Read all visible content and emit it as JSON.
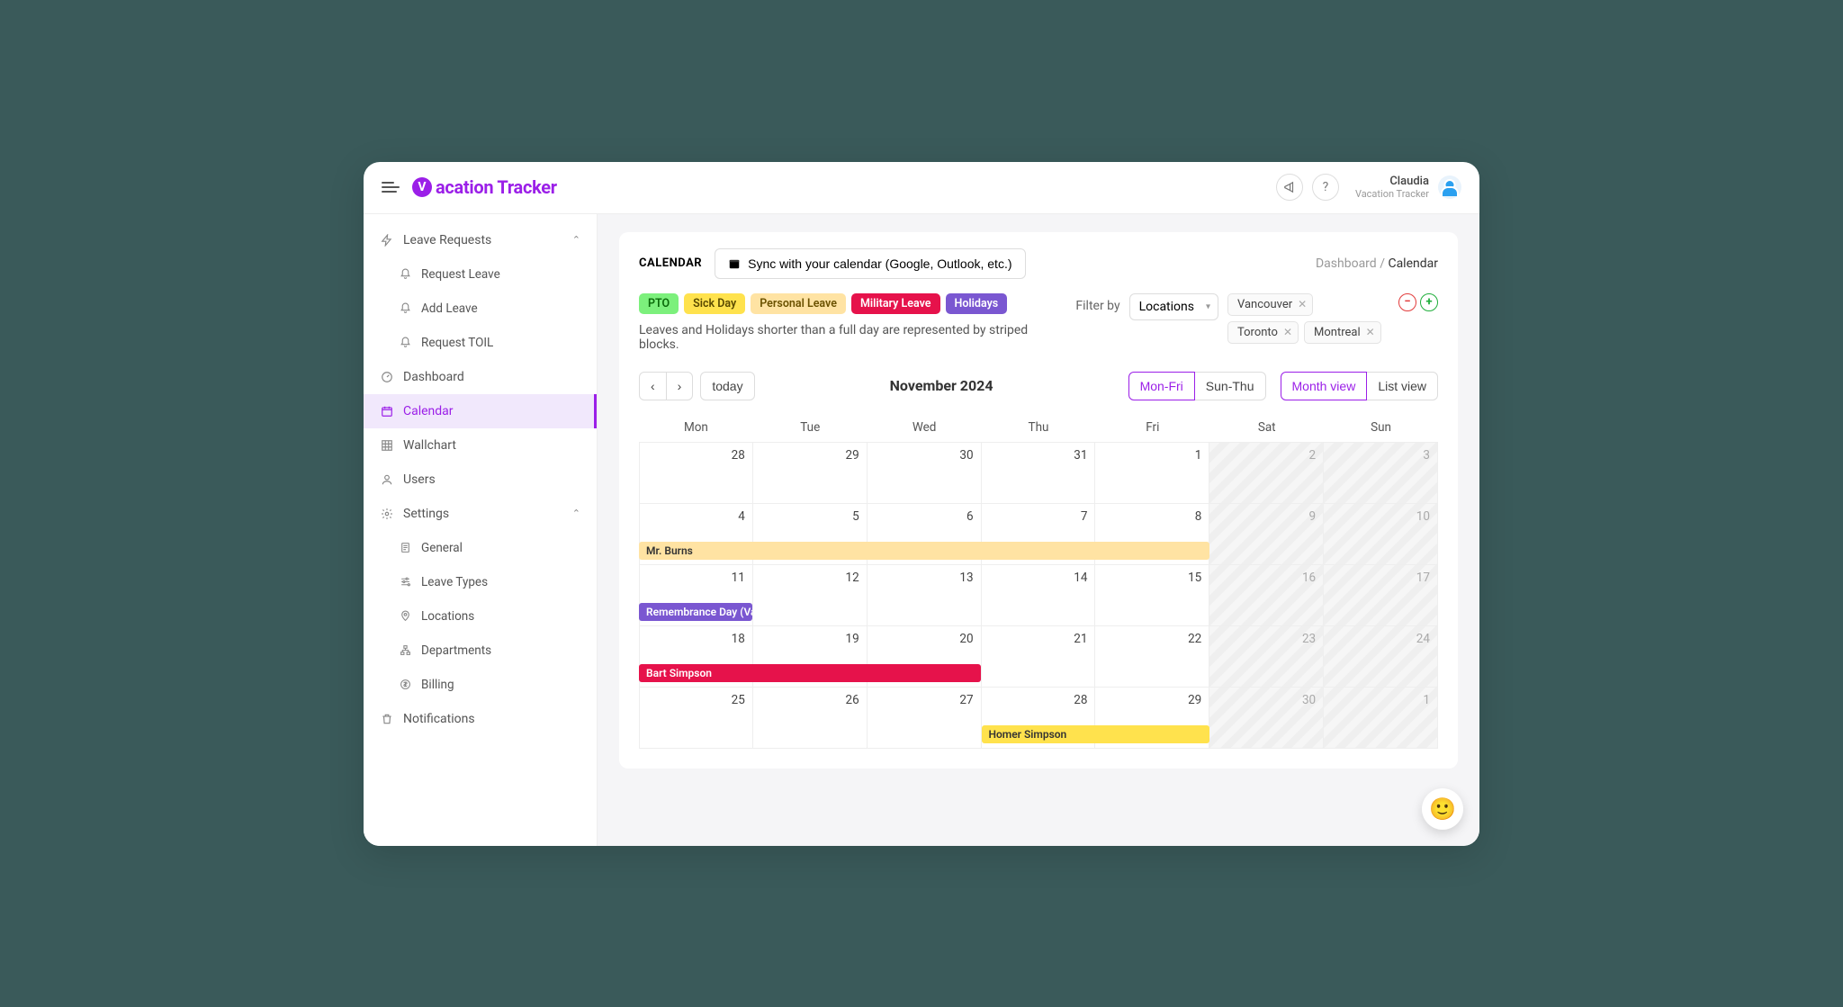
{
  "brand": {
    "text": "acation Tracker",
    "badge": "V"
  },
  "header": {
    "user_name": "Claudia",
    "user_sub": "Vacation Tracker"
  },
  "sidebar": {
    "leave_requests": "Leave Requests",
    "request_leave": "Request Leave",
    "add_leave": "Add Leave",
    "request_toil": "Request TOIL",
    "dashboard": "Dashboard",
    "calendar": "Calendar",
    "wallchart": "Wallchart",
    "users": "Users",
    "settings": "Settings",
    "general": "General",
    "leave_types": "Leave Types",
    "locations": "Locations",
    "departments": "Departments",
    "billing": "Billing",
    "notifications": "Notifications"
  },
  "page": {
    "label": "CALENDAR",
    "sync": "Sync with your calendar (Google, Outlook, etc.)",
    "breadcrumb_root": "Dashboard",
    "breadcrumb_sep": "/",
    "breadcrumb_cur": "Calendar",
    "legend": {
      "pto": "PTO",
      "sick": "Sick Day",
      "personal": "Personal Leave",
      "military": "Military Leave",
      "holidays": "Holidays"
    },
    "note": "Leaves and Holidays shorter than a full day are represented by striped blocks.",
    "filter_label": "Filter by",
    "filter_select": "Locations",
    "chips": {
      "c0": "Vancouver",
      "c1": "Toronto",
      "c2": "Montreal"
    },
    "today": "today",
    "month": "November 2024",
    "monfri": "Mon-Fri",
    "sunthu": "Sun-Thu",
    "monthview": "Month view",
    "listview": "List view",
    "dow": {
      "d0": "Mon",
      "d1": "Tue",
      "d2": "Wed",
      "d3": "Thu",
      "d4": "Fri",
      "d5": "Sat",
      "d6": "Sun"
    },
    "weeks": {
      "w0": {
        "c0": "28",
        "c1": "29",
        "c2": "30",
        "c3": "31",
        "c4": "1",
        "c5": "2",
        "c6": "3"
      },
      "w1": {
        "c0": "4",
        "c1": "5",
        "c2": "6",
        "c3": "7",
        "c4": "8",
        "c5": "9",
        "c6": "10"
      },
      "w2": {
        "c0": "11",
        "c1": "12",
        "c2": "13",
        "c3": "14",
        "c4": "15",
        "c5": "16",
        "c6": "17"
      },
      "w3": {
        "c0": "18",
        "c1": "19",
        "c2": "20",
        "c3": "21",
        "c4": "22",
        "c5": "23",
        "c6": "24"
      },
      "w4": {
        "c0": "25",
        "c1": "26",
        "c2": "27",
        "c3": "28",
        "c4": "29",
        "c5": "30",
        "c6": "1"
      }
    },
    "events": {
      "burns": "Mr. Burns",
      "remembrance": "Remembrance Day (Va",
      "bart": "Bart Simpson",
      "homer": "Homer Simpson"
    }
  }
}
